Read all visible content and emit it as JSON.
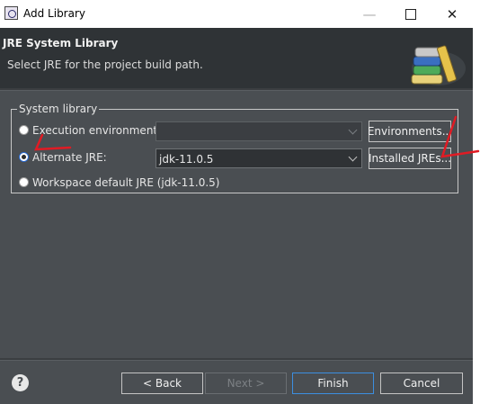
{
  "window": {
    "title": "Add Library"
  },
  "banner": {
    "title": "JRE System Library",
    "description": "Select JRE for the project build path."
  },
  "group": {
    "legend": "System library",
    "options": [
      {
        "label": "Execution environment:",
        "selected": false,
        "combo_value": "",
        "combo_enabled": false,
        "button": "Environments..."
      },
      {
        "label": "Alternate JRE:",
        "selected": true,
        "combo_value": "jdk-11.0.5",
        "combo_enabled": true,
        "button": "Installed JREs..."
      },
      {
        "label": "Workspace default JRE (jdk-11.0.5)",
        "selected": false
      }
    ]
  },
  "footer": {
    "help_icon": "?",
    "back": "< Back",
    "next": "Next >",
    "finish": "Finish",
    "cancel": "Cancel"
  },
  "colors": {
    "dialog_bg": "#4a4e52",
    "banner_bg": "#2f3336",
    "focus_border": "#3c8ee0",
    "annotation_red": "#e01b24"
  }
}
